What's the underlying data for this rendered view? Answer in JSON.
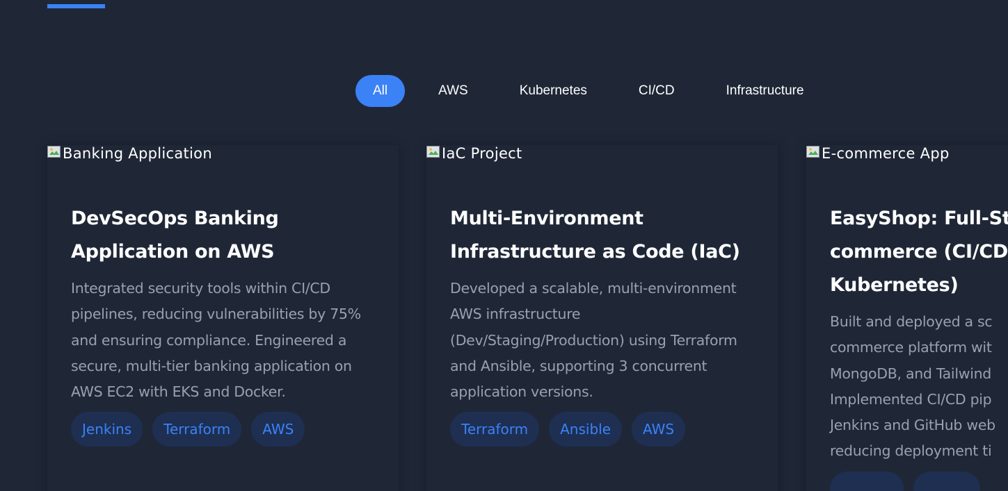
{
  "filters": [
    {
      "label": "All",
      "active": true
    },
    {
      "label": "AWS",
      "active": false
    },
    {
      "label": "Kubernetes",
      "active": false
    },
    {
      "label": "CI/CD",
      "active": false
    },
    {
      "label": "Infrastructure",
      "active": false
    }
  ],
  "projects": [
    {
      "image_alt": "Banking Application",
      "title": "DevSecOps Banking Application on AWS",
      "description": "Integrated security tools within CI/CD pipelines, reducing vulnerabilities by 75% and ensuring compliance. Engineered a secure, multi-tier banking application on AWS EC2 with EKS and Docker.",
      "tags": [
        "Jenkins",
        "Terraform",
        "AWS"
      ]
    },
    {
      "image_alt": "IaC Project",
      "title": "Multi-Environment Infrastructure as Code (IaC)",
      "description": "Developed a scalable, multi-environment AWS infrastructure (Dev/Staging/Production) using Terraform and Ansible, supporting 3 concurrent application versions.",
      "tags": [
        "Terraform",
        "Ansible",
        "AWS"
      ]
    },
    {
      "image_alt": "E-commerce App",
      "title": "EasyShop: Full-St commerce (CI/CD Kubernetes)",
      "description": "Built and deployed a sc commerce platform wit MongoDB, and Tailwind Implemented CI/CD pip Jenkins and GitHub web reducing deployment ti",
      "tags": [
        "",
        ""
      ]
    }
  ],
  "colors": {
    "background": "#1f2737",
    "accent": "#3b82f6",
    "tag_bg": "#1e2f52",
    "muted_text": "#98a1b0"
  }
}
